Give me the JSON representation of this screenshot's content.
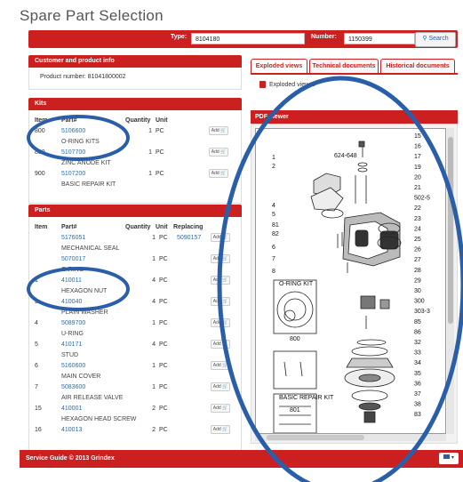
{
  "page_title": "Spare Part Selection",
  "search": {
    "type_label": "Type:",
    "type_value": "8104180",
    "number_label": "Number:",
    "number_value": "1150399",
    "button_label": "Search",
    "button_icon": "search-icon"
  },
  "customer": {
    "header": "Customer and product info",
    "product_number_text": "Product number: 81041800002"
  },
  "kits": {
    "header": "Kits",
    "columns": [
      "Item",
      "Part#",
      "Quantity",
      "Unit"
    ],
    "rows": [
      {
        "item": "800",
        "part": "5106600",
        "qty": "1",
        "unit": "PC",
        "desc": "O-RING KITS"
      },
      {
        "item": "800",
        "part": "5107700",
        "qty": "1",
        "unit": "PC",
        "desc": "ZINC ANODE KIT"
      },
      {
        "item": "900",
        "part": "5107200",
        "qty": "1",
        "unit": "PC",
        "desc": "BASIC REPAIR KIT"
      }
    ],
    "add_label": "Add"
  },
  "parts": {
    "header": "Parts",
    "columns": [
      "Item",
      "Part#",
      "Quantity",
      "Unit",
      "Replacing"
    ],
    "rows": [
      {
        "item": "",
        "part": "5176051",
        "qty": "1",
        "unit": "PC",
        "replacing": "5090157",
        "desc": "MECHANICAL SEAL"
      },
      {
        "item": "",
        "part": "5070017",
        "qty": "1",
        "unit": "PC",
        "replacing": "",
        "desc": "O-RING"
      },
      {
        "item": "1",
        "part": "410011",
        "qty": "4",
        "unit": "PC",
        "replacing": "",
        "desc": "HEXAGON NUT"
      },
      {
        "item": "3",
        "part": "410040",
        "qty": "4",
        "unit": "PC",
        "replacing": "",
        "desc": "PLAIN WASHER"
      },
      {
        "item": "4",
        "part": "5089700",
        "qty": "1",
        "unit": "PC",
        "replacing": "",
        "desc": "U-RING"
      },
      {
        "item": "5",
        "part": "410171",
        "qty": "4",
        "unit": "PC",
        "replacing": "",
        "desc": "STUD"
      },
      {
        "item": "6",
        "part": "5160600",
        "qty": "1",
        "unit": "PC",
        "replacing": "",
        "desc": "MAIN COVER"
      },
      {
        "item": "7",
        "part": "5083600",
        "qty": "1",
        "unit": "PC",
        "replacing": "",
        "desc": "AIR RELEASE VALVE"
      },
      {
        "item": "15",
        "part": "410001",
        "qty": "2",
        "unit": "PC",
        "replacing": "",
        "desc": "HEXAGON HEAD SCREW"
      },
      {
        "item": "16",
        "part": "410013",
        "qty": "2",
        "unit": "PC",
        "replacing": "",
        "desc": ""
      }
    ],
    "add_label": "Add"
  },
  "tabs": [
    {
      "label": "Exploded views",
      "active": true
    },
    {
      "label": "Technical documents",
      "active": false
    },
    {
      "label": "Historical documents",
      "active": false
    }
  ],
  "exploded_view_link": "Exploded view 1",
  "pdf_viewer_header": "PDF viewer",
  "drawing": {
    "left_callouts": [
      "1",
      "2",
      "4",
      "5",
      "81",
      "82",
      "6",
      "7",
      "8"
    ],
    "top_callout": "624-648",
    "right_callouts": [
      "15",
      "16",
      "17",
      "19",
      "20",
      "21",
      "502-5",
      "22",
      "23",
      "24",
      "25",
      "26",
      "27",
      "28",
      "29",
      "30",
      "300",
      "303-3",
      "85",
      "86",
      "32",
      "33",
      "34",
      "35",
      "36",
      "37",
      "38",
      "83"
    ],
    "kit_boxes": [
      {
        "title": "O-RING KIT",
        "number": "800"
      },
      {
        "title": "",
        "number": "801"
      },
      {
        "title": "BASIC REPAIR KIT",
        "number": ""
      }
    ]
  },
  "footer": {
    "text": "Service Guide © 2013 Grindex",
    "language": "▾"
  },
  "colors": {
    "brand_red": "#cc1f1f",
    "link_blue": "#2b6cb0",
    "annotation_blue": "#2a5ea8"
  }
}
